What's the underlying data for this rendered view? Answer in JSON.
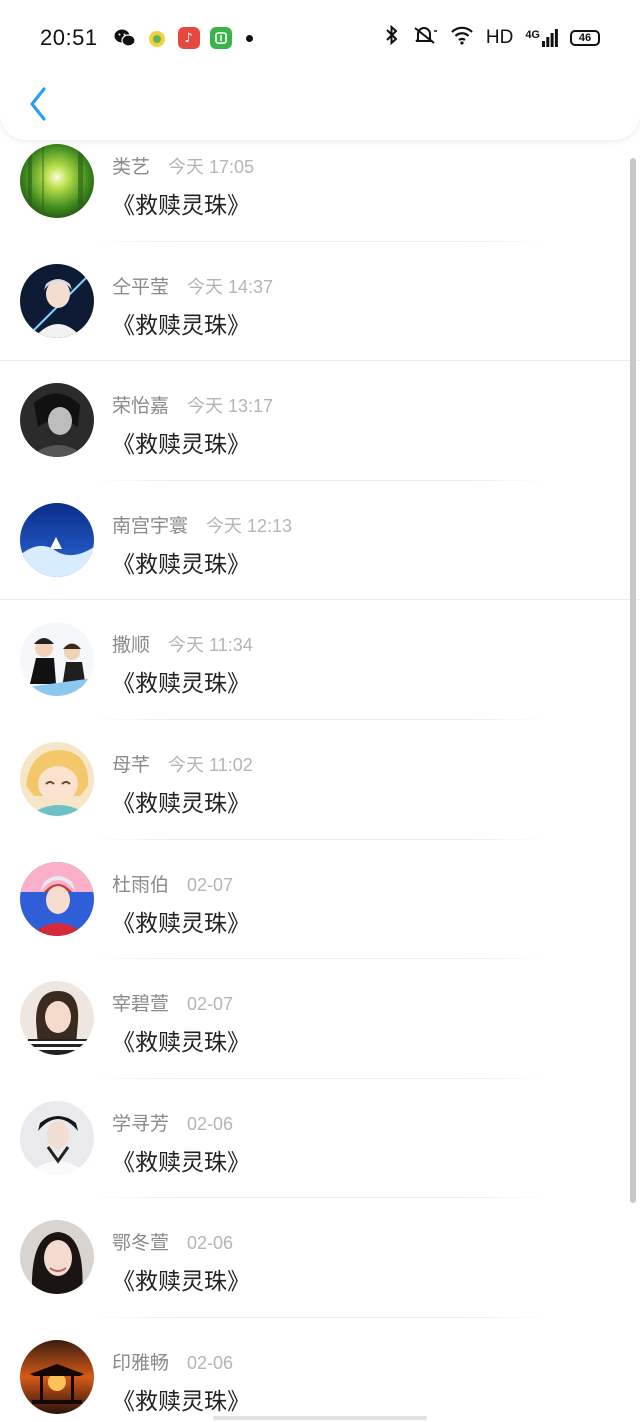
{
  "status_bar": {
    "time": "20:51",
    "network_label": "HD",
    "signal_label": "4G",
    "battery_level": "46",
    "icons": [
      "wechat-icon",
      "app-yellow-icon",
      "music-app-icon",
      "green-app-icon",
      "bluetooth-icon",
      "mute-icon",
      "wifi-icon",
      "signal-icon",
      "battery-icon"
    ]
  },
  "header": {
    "back_icon": "chevron-left-icon",
    "accent_color": "#2a9df4"
  },
  "messages": [
    {
      "name": "类艺",
      "time": "今天 17:05",
      "text": "《救赎灵珠》"
    },
    {
      "name": "仝平莹",
      "time": "今天 14:37",
      "text": "《救赎灵珠》"
    },
    {
      "name": "荣怡嘉",
      "time": "今天 13:17",
      "text": "《救赎灵珠》"
    },
    {
      "name": "南宫宇寰",
      "time": "今天 12:13",
      "text": "《救赎灵珠》"
    },
    {
      "name": "撒顺",
      "time": "今天 11:34",
      "text": "《救赎灵珠》"
    },
    {
      "name": "母芊",
      "time": "今天 11:02",
      "text": "《救赎灵珠》"
    },
    {
      "name": "杜雨伯",
      "time": "02-07",
      "text": "《救赎灵珠》"
    },
    {
      "name": "宰碧萱",
      "time": "02-07",
      "text": "《救赎灵珠》"
    },
    {
      "name": "学寻芳",
      "time": "02-06",
      "text": "《救赎灵珠》"
    },
    {
      "name": "鄂冬萱",
      "time": "02-06",
      "text": "《救赎灵珠》"
    },
    {
      "name": "印雅畅",
      "time": "02-06",
      "text": "《救赎灵珠》"
    }
  ]
}
